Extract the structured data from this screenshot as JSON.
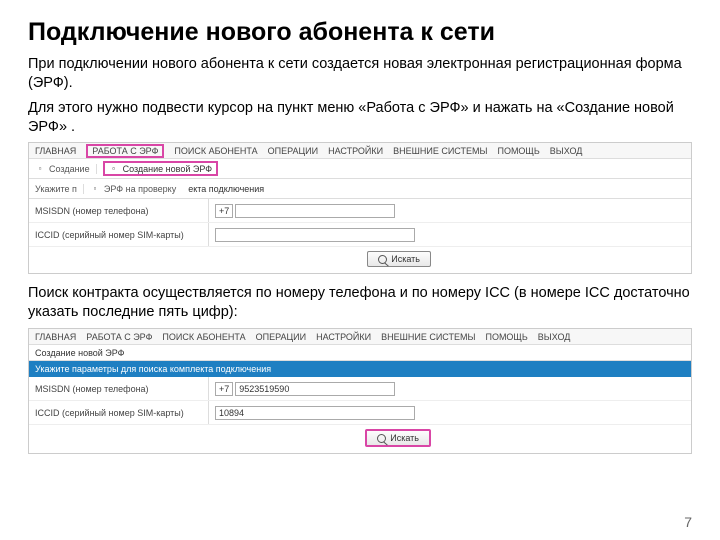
{
  "title": "Подключение нового абонента к сети",
  "p1": "При подключении нового абонента к сети создается новая электронная регистрационная форма (ЭРФ).",
  "p2": "Для этого нужно подвести курсор на пункт меню «Работа с ЭРФ» и нажать на «Создание новой ЭРФ» .",
  "p3": "Поиск контракта осуществляется по номеру телефона и по номеру ICC (в номере ICC достаточно указать последние пять цифр):",
  "shot1": {
    "menu": {
      "m1": "ГЛАВНАЯ",
      "m2": "РАБОТА С ЭРФ",
      "m3": "ПОИСК АБОНЕНТА",
      "m4": "ОПЕРАЦИИ",
      "m5": "НАСТРОЙКИ",
      "m6": "ВНЕШНИЕ СИСТЕМЫ",
      "m7": "ПОМОЩЬ",
      "m8": "ВЫХОД"
    },
    "tab": "Создание",
    "dd1": "Создание новой ЭРФ",
    "dd2": "ЭРФ на проверку",
    "hint": "екта подключения",
    "row_msisdn": "MSISDN (номер телефона)",
    "row_iccid": "ICCID (серийный номер SIM-карты)",
    "prefix": "+7",
    "search": "Искать"
  },
  "shot2": {
    "menu": {
      "m1": "ГЛАВНАЯ",
      "m2": "РАБОТА С ЭРФ",
      "m3": "ПОИСК АБОНЕНТА",
      "m4": "ОПЕРАЦИИ",
      "m5": "НАСТРОЙКИ",
      "m6": "ВНЕШНИЕ СИСТЕМЫ",
      "m7": "ПОМОЩЬ",
      "m8": "ВЫХОД"
    },
    "header": "Создание новой ЭРФ",
    "bar": "Укажите параметры для поиска комплекта подключения",
    "row_msisdn": "MSISDN (номер телефона)",
    "row_iccid": "ICCID (серийный номер SIM-карты)",
    "prefix": "+7",
    "msisdn_val": "9523519590",
    "iccid_val": "10894",
    "search": "Искать"
  },
  "page": "7"
}
